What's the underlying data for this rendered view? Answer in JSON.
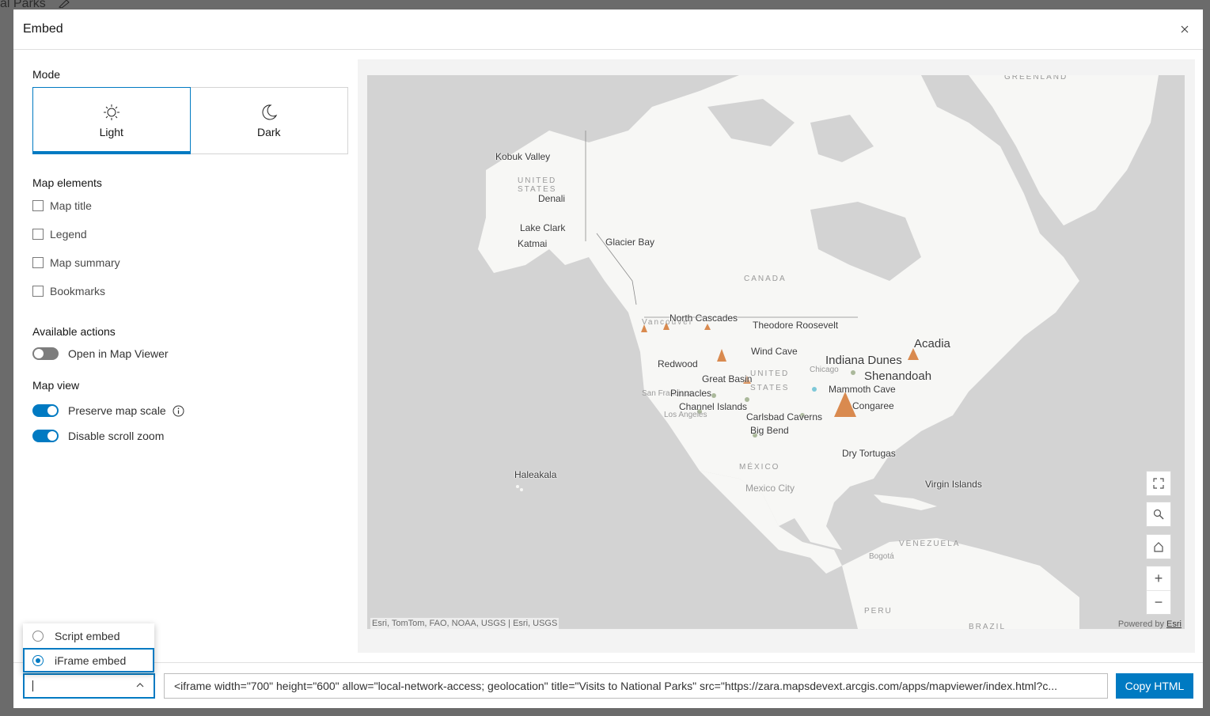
{
  "background": {
    "title_fragment": "al Parks"
  },
  "dialog": {
    "title": "Embed",
    "close_symbol": "×"
  },
  "mode": {
    "title": "Mode",
    "light_label": "Light",
    "dark_label": "Dark",
    "selected": "Light"
  },
  "map_elements": {
    "title": "Map elements",
    "items": [
      {
        "label": "Map title",
        "checked": false
      },
      {
        "label": "Legend",
        "checked": false
      },
      {
        "label": "Map summary",
        "checked": false
      },
      {
        "label": "Bookmarks",
        "checked": false
      }
    ]
  },
  "available_actions": {
    "title": "Available actions",
    "open_in_map_viewer": {
      "label": "Open in Map Viewer",
      "on": false
    }
  },
  "map_view": {
    "title": "Map view",
    "preserve_map_scale": {
      "label": "Preserve map scale",
      "on": true
    },
    "disable_scroll_zoom": {
      "label": "Disable scroll zoom",
      "on": true
    }
  },
  "map": {
    "countries": [
      "GREENLAND",
      "UNITED",
      "STATES",
      "CANADA",
      "UNITED",
      "STATES",
      "MÉXICO",
      "VENEZUELA",
      "PERU",
      "BRAZIL"
    ],
    "cities": [
      "Vancouver",
      "San Francisco",
      "Los Angeles",
      "Chicago",
      "Mexico City",
      "Bogotá"
    ],
    "parks": [
      "Kobuk Valley",
      "Denali",
      "Lake Clark",
      "Katmai",
      "Glacier Bay",
      "North Cascades",
      "Theodore Roosevelt",
      "Wind Cave",
      "Redwood",
      "Great Basin",
      "Pinnacles",
      "Channel Islands",
      "Carlsbad Caverns",
      "Big Bend",
      "Indiana Dunes",
      "Acadia",
      "Shenandoah",
      "Mammoth Cave",
      "Congaree",
      "Dry Tortugas",
      "Virgin Islands",
      "Haleakala"
    ],
    "attribution": "Esri, TomTom, FAO, NOAA, USGS | Esri, USGS",
    "powered_by": "Powered by",
    "powered_by_link": "Esri",
    "zoom_in": "+",
    "zoom_out": "−",
    "colors": {
      "land": "#f7f7f5",
      "water": "#d3d3d3",
      "park_marker": "#d98a4f"
    }
  },
  "embed_type": {
    "options": [
      "Script embed",
      "iFrame embed"
    ],
    "selected": "iFrame embed"
  },
  "footer": {
    "code": "<iframe width=\"700\" height=\"600\" allow=\"local-network-access; geolocation\" title=\"Visits to National Parks\" src=\"https://zara.mapsdevext.arcgis.com/apps/mapviewer/index.html?c...",
    "copy_label": "Copy HTML"
  },
  "accent_color": "#007ac2"
}
